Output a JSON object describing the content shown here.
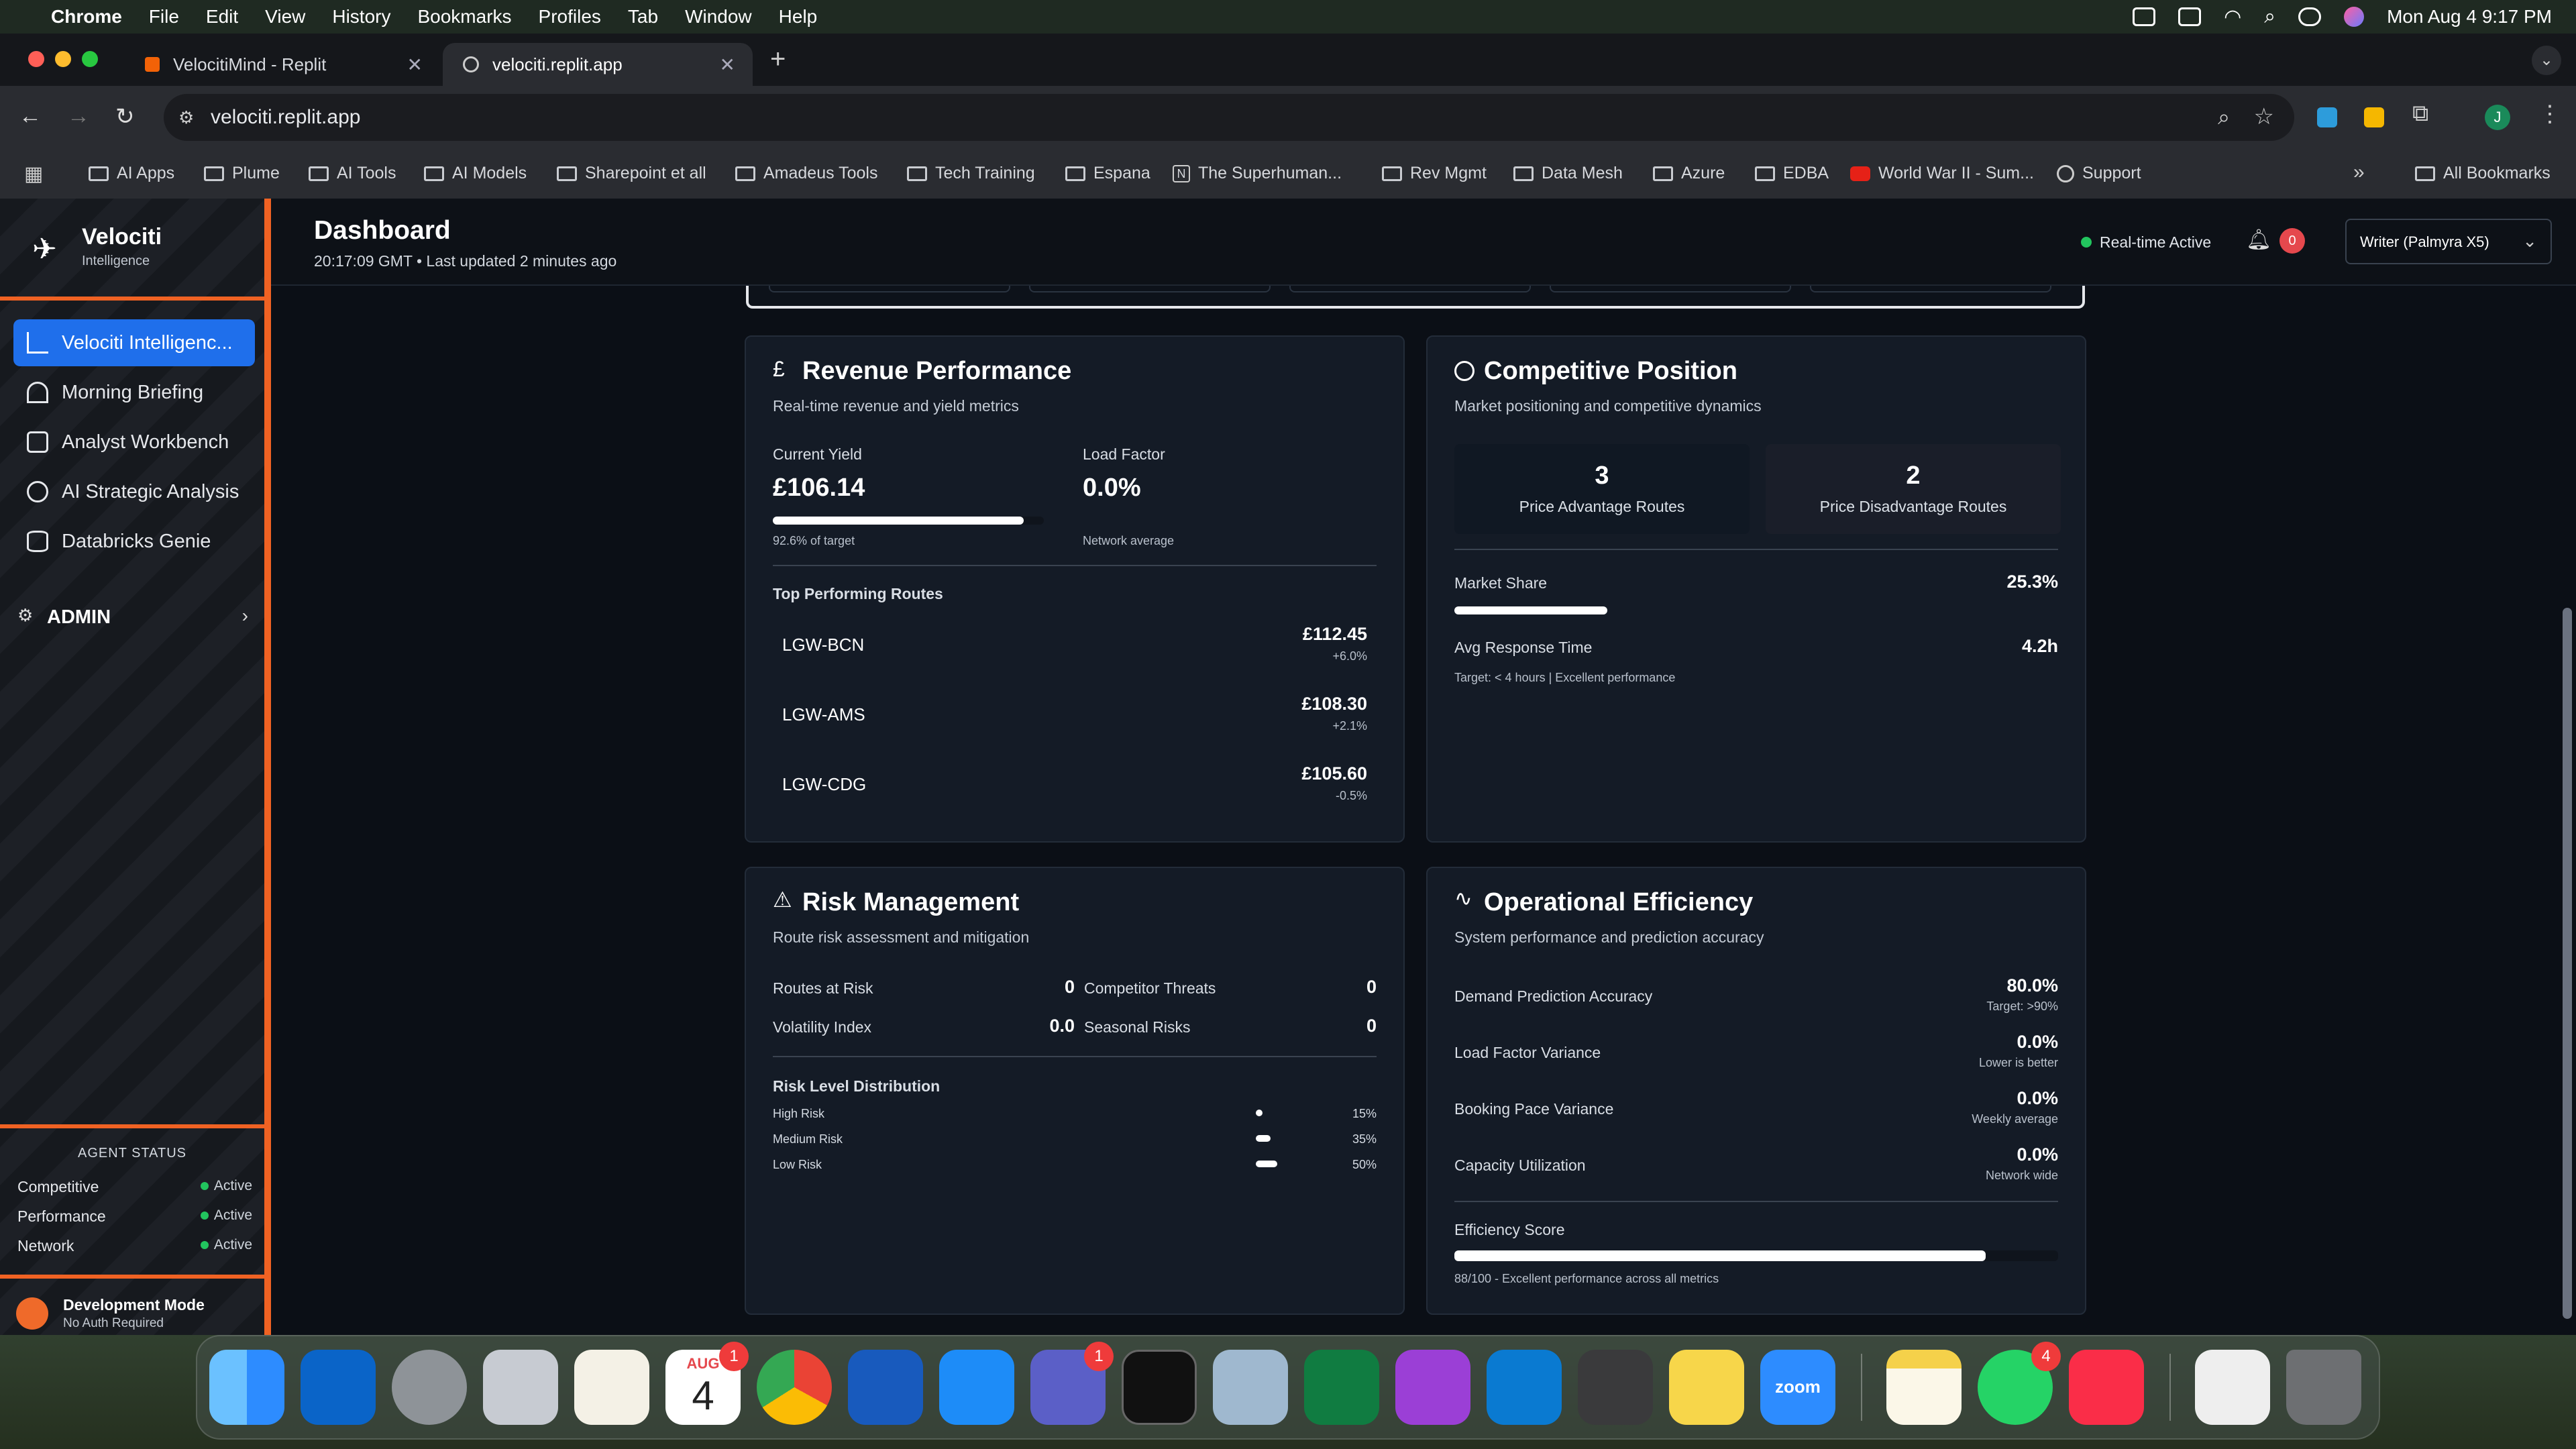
{
  "menubar": {
    "app": "Chrome",
    "items": [
      "File",
      "Edit",
      "View",
      "History",
      "Bookmarks",
      "Profiles",
      "Tab",
      "Window",
      "Help"
    ],
    "clock": "Mon Aug 4  9:17 PM"
  },
  "browser": {
    "tabs": [
      {
        "title": "VelocitiMind - Replit"
      },
      {
        "title": "velociti.replit.app"
      }
    ],
    "url": "velociti.replit.app",
    "profile_initial": "J",
    "bookmarks": [
      "AI Apps",
      "Plume",
      "AI Tools",
      "AI Models",
      "Sharepoint et all",
      "Amadeus Tools",
      "Tech Training",
      "Espana",
      "The Superhuman...",
      "Rev Mgmt",
      "Data Mesh",
      "Azure",
      "EDBA",
      "World War II - Sum...",
      "Support"
    ],
    "all_bookmarks": "All Bookmarks"
  },
  "sidebar": {
    "brand": "Velociti",
    "brand_sub": "Intelligence",
    "nav": [
      {
        "label": "Velociti Intelligenc...",
        "icon": "chart-line-icon"
      },
      {
        "label": "Morning Briefing",
        "icon": "sunrise-icon"
      },
      {
        "label": "Analyst Workbench",
        "icon": "clipboard-icon"
      },
      {
        "label": "AI Strategic Analysis",
        "icon": "brain-icon"
      },
      {
        "label": "Databricks Genie",
        "icon": "database-icon"
      }
    ],
    "admin": "ADMIN",
    "agent_status_title": "AGENT STATUS",
    "agents": [
      {
        "name": "Competitive",
        "status": "Active"
      },
      {
        "name": "Performance",
        "status": "Active"
      },
      {
        "name": "Network",
        "status": "Active"
      }
    ],
    "dev_mode": "Development Mode",
    "dev_sub": "No Auth Required"
  },
  "header": {
    "title": "Dashboard",
    "subtitle": "20:17:09 GMT • Last updated 2 minutes ago",
    "realtime": "Real-time Active",
    "notifications": "0",
    "model": "Writer (Palmyra X5)"
  },
  "revenue": {
    "title": "Revenue Performance",
    "subtitle": "Real-time revenue and yield metrics",
    "yield_label": "Current Yield",
    "yield_value": "£106.14",
    "yield_note": "92.6% of target",
    "yield_progress": 0.926,
    "load_label": "Load Factor",
    "load_value": "0.0%",
    "load_note": "Network average",
    "routes_title": "Top Performing Routes",
    "routes": [
      {
        "route": "LGW-BCN",
        "value": "£112.45",
        "change": "+6.0%"
      },
      {
        "route": "LGW-AMS",
        "value": "£108.30",
        "change": "+2.1%"
      },
      {
        "route": "LGW-CDG",
        "value": "£105.60",
        "change": "-0.5%"
      }
    ]
  },
  "competitive": {
    "title": "Competitive Position",
    "subtitle": "Market positioning and competitive dynamics",
    "adv_value": "3",
    "adv_label": "Price Advantage Routes",
    "dis_value": "2",
    "dis_label": "Price Disadvantage Routes",
    "share_label": "Market Share",
    "share_value": "25.3%",
    "share_progress": 0.253,
    "resp_label": "Avg Response Time",
    "resp_value": "4.2h",
    "resp_note": "Target: < 4 hours | Excellent performance"
  },
  "risk": {
    "title": "Risk Management",
    "subtitle": "Route risk assessment and mitigation",
    "metrics": [
      {
        "label": "Routes at Risk",
        "value": "0"
      },
      {
        "label": "Competitor Threats",
        "value": "0"
      },
      {
        "label": "Volatility Index",
        "value": "0.0"
      },
      {
        "label": "Seasonal Risks",
        "value": "0"
      }
    ],
    "dist_title": "Risk Level Distribution",
    "dist": [
      {
        "label": "High Risk",
        "pct": "15%",
        "fraction": 0.15
      },
      {
        "label": "Medium Risk",
        "pct": "35%",
        "fraction": 0.35
      },
      {
        "label": "Low Risk",
        "pct": "50%",
        "fraction": 0.5
      }
    ]
  },
  "ops": {
    "title": "Operational Efficiency",
    "subtitle": "System performance and prediction accuracy",
    "metrics": [
      {
        "label": "Demand Prediction Accuracy",
        "value": "80.0%",
        "note": "Target: >90%"
      },
      {
        "label": "Load Factor Variance",
        "value": "0.0%",
        "note": "Lower is better"
      },
      {
        "label": "Booking Pace Variance",
        "value": "0.0%",
        "note": "Weekly average"
      },
      {
        "label": "Capacity Utilization",
        "value": "0.0%",
        "note": "Network wide"
      }
    ],
    "score_label": "Efficiency Score",
    "score_progress": 0.88,
    "score_note": "88/100 - Excellent performance across all metrics"
  },
  "dock": {
    "calendar_month": "AUG",
    "calendar_day": "4",
    "badges": {
      "calendar": "1",
      "teams": "1",
      "whatsapp": "4"
    },
    "zoom_label": "zoom"
  }
}
